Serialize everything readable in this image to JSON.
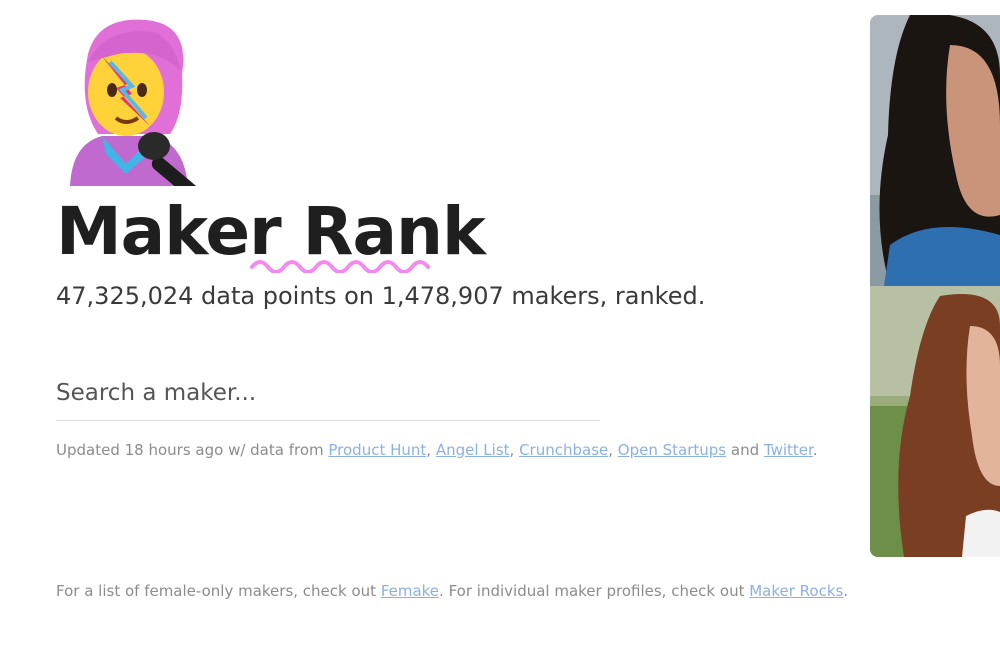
{
  "brand": {
    "logo_icon": "woman-singer-emoji-icon",
    "title": "Maker Rank",
    "accent_color": "#f28bef"
  },
  "stats": {
    "subtitle": "47,325,024 data points on 1,478,907 makers, ranked."
  },
  "search": {
    "placeholder": "Search a maker..."
  },
  "sources": {
    "prefix": "Updated 18 hours ago w/ data from ",
    "links": [
      "Product Hunt",
      "Angel List",
      "Crunchbase",
      "Open Startups",
      "Twitter"
    ],
    "sep_comma": ", ",
    "sep_and": " and ",
    "suffix": "."
  },
  "footer": {
    "part1": "For a list of female-only makers, check out ",
    "link1": "Femake",
    "part2": ". For individual maker profiles, check out ",
    "link2": "Maker Rocks",
    "part3": "."
  },
  "photos": [
    {
      "icon": "maker-photo-dark-hair"
    },
    {
      "icon": "maker-photo-long-brown-hair"
    }
  ],
  "colors": {
    "link": "#8bb1e4",
    "muted_text": "#8c8c8c"
  }
}
